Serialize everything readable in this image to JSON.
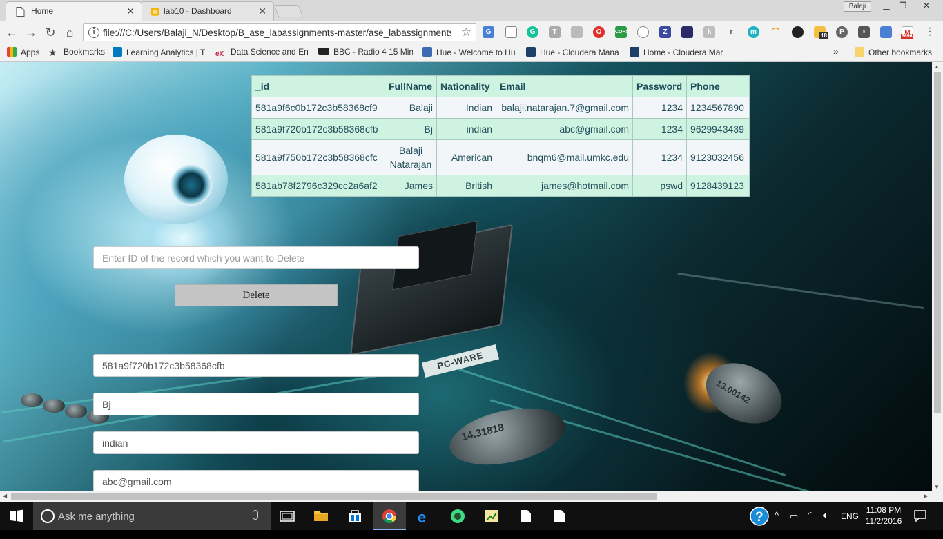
{
  "browser": {
    "profile": "Balaji",
    "tabs": [
      {
        "label": "Home",
        "active": true
      },
      {
        "label": "lab10 - Dashboard",
        "active": false
      }
    ],
    "url": "file:///C:/Users/Balaji_N/Desktop/B_ase_labassignments-master/ase_labassignments"
  },
  "bookmarks": {
    "items": [
      "Apps",
      "Bookmarks",
      "Learning Analytics | Tr",
      "Data Science and Eng",
      "BBC - Radio 4 15 Min",
      "Hue - Welcome to Hu",
      "Hue - Cloudera Mana",
      "Home - Cloudera Mar"
    ],
    "overflow": "»",
    "other": "Other bookmarks"
  },
  "extensions": {
    "badge_18": "18",
    "badge_3696": "3696",
    "cors": "CORS"
  },
  "table": {
    "headers": [
      "_id",
      "FullName",
      "Nationality",
      "Email",
      "Password",
      "Phone"
    ],
    "rows": [
      [
        "581a9f6c0b172c3b58368cf9",
        "Balaji",
        "Indian",
        "balaji.natarajan.7@gmail.com",
        "1234",
        "1234567890"
      ],
      [
        "581a9f720b172c3b58368cfb",
        "Bj",
        "indian",
        "abc@gmail.com",
        "1234",
        "9629943439"
      ],
      [
        "581a9f750b172c3b58368cfc",
        "Balaji Natarajan",
        "American",
        "bnqm6@mail.umkc.edu",
        "1234",
        "9123032456"
      ],
      [
        "581ab78f2796c329cc2a6af2",
        "James",
        "British",
        "james@hotmail.com",
        "pswd",
        "9128439123"
      ]
    ]
  },
  "delete_form": {
    "placeholder": "Enter ID of the record which you want to Delete",
    "button": "Delete"
  },
  "update_form": {
    "id": "581a9f720b172c3b58368cfb",
    "fullname": "Bj",
    "nationality": "indian",
    "email": "abc@gmail.com"
  },
  "background": {
    "chip_label": "PC-WARE",
    "cap1": "14.31818",
    "cap2": "13.00142"
  },
  "taskbar": {
    "search": "Ask me anything",
    "language": "ENG",
    "time": "11:08 PM",
    "date": "11/2/2016"
  }
}
